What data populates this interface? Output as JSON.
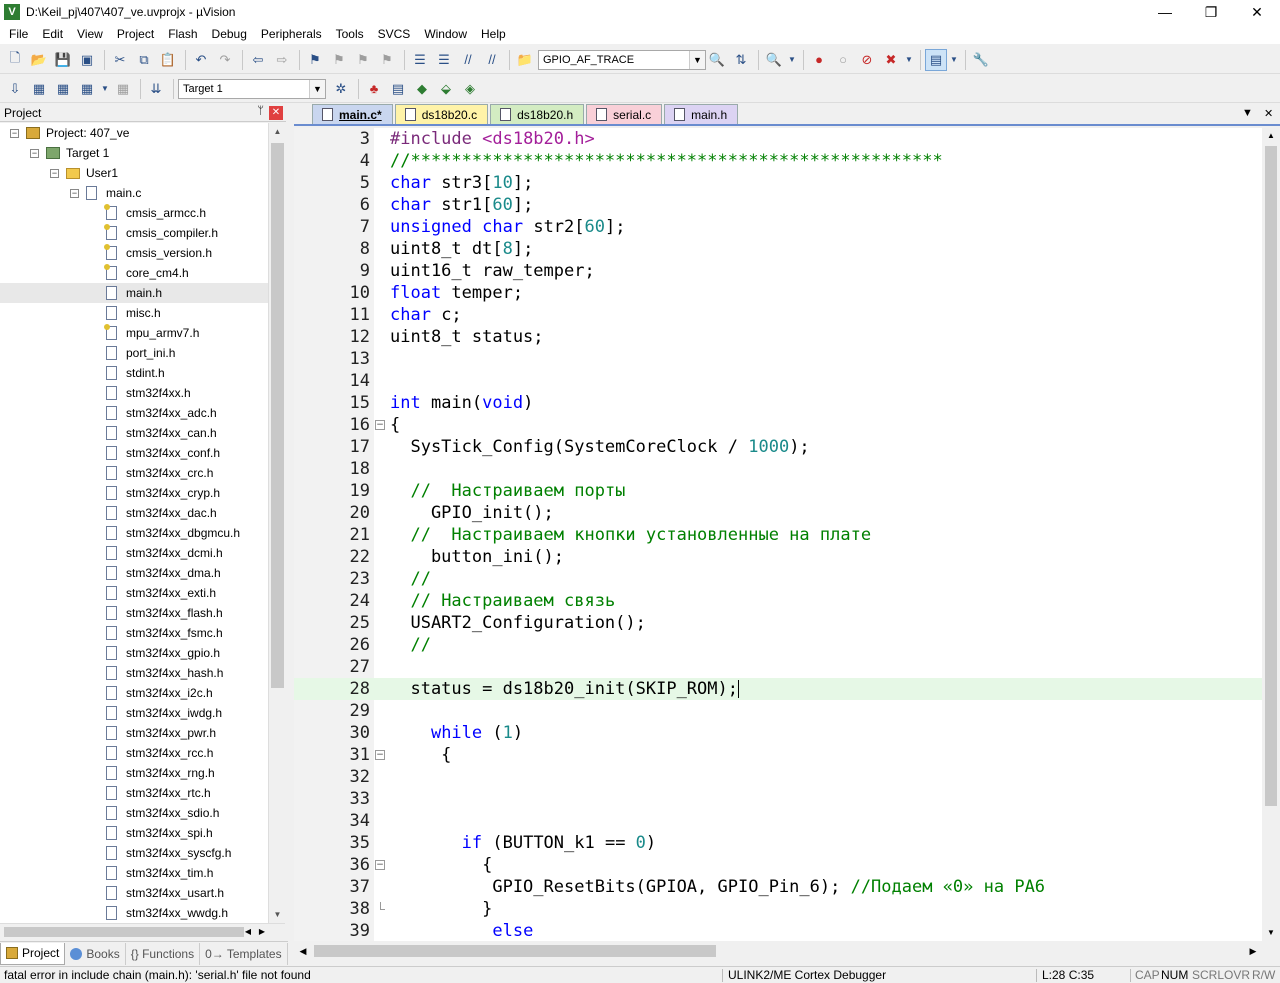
{
  "window": {
    "title": "D:\\Keil_pj\\407\\407_ve.uvprojx - µVision",
    "minimize": "—",
    "maximize": "❐",
    "close": "✕"
  },
  "menu": [
    "File",
    "Edit",
    "View",
    "Project",
    "Flash",
    "Debug",
    "Peripherals",
    "Tools",
    "SVCS",
    "Window",
    "Help"
  ],
  "toolbar1": {
    "find_combo": "GPIO_AF_TRACE"
  },
  "toolbar2": {
    "target_combo": "Target 1"
  },
  "project_pane": {
    "title": "Project",
    "pin": "ᛘ",
    "close": "✕",
    "tree": [
      {
        "label": "Project: 407_ve",
        "level": 0,
        "type": "proj",
        "expand": "−"
      },
      {
        "label": "Target 1",
        "level": 1,
        "type": "target",
        "expand": "−"
      },
      {
        "label": "User1",
        "level": 2,
        "type": "folder",
        "expand": "−"
      },
      {
        "label": "main.c",
        "level": 3,
        "type": "cfile",
        "expand": "−"
      },
      {
        "label": "cmsis_armcc.h",
        "level": 4,
        "type": "key"
      },
      {
        "label": "cmsis_compiler.h",
        "level": 4,
        "type": "key"
      },
      {
        "label": "cmsis_version.h",
        "level": 4,
        "type": "key"
      },
      {
        "label": "core_cm4.h",
        "level": 4,
        "type": "key"
      },
      {
        "label": "main.h",
        "level": 4,
        "type": "file",
        "selected": true
      },
      {
        "label": "misc.h",
        "level": 4,
        "type": "file"
      },
      {
        "label": "mpu_armv7.h",
        "level": 4,
        "type": "key"
      },
      {
        "label": "port_ini.h",
        "level": 4,
        "type": "file"
      },
      {
        "label": "stdint.h",
        "level": 4,
        "type": "file"
      },
      {
        "label": "stm32f4xx.h",
        "level": 4,
        "type": "file"
      },
      {
        "label": "stm32f4xx_adc.h",
        "level": 4,
        "type": "file"
      },
      {
        "label": "stm32f4xx_can.h",
        "level": 4,
        "type": "file"
      },
      {
        "label": "stm32f4xx_conf.h",
        "level": 4,
        "type": "file"
      },
      {
        "label": "stm32f4xx_crc.h",
        "level": 4,
        "type": "file"
      },
      {
        "label": "stm32f4xx_cryp.h",
        "level": 4,
        "type": "file"
      },
      {
        "label": "stm32f4xx_dac.h",
        "level": 4,
        "type": "file"
      },
      {
        "label": "stm32f4xx_dbgmcu.h",
        "level": 4,
        "type": "file"
      },
      {
        "label": "stm32f4xx_dcmi.h",
        "level": 4,
        "type": "file"
      },
      {
        "label": "stm32f4xx_dma.h",
        "level": 4,
        "type": "file"
      },
      {
        "label": "stm32f4xx_exti.h",
        "level": 4,
        "type": "file"
      },
      {
        "label": "stm32f4xx_flash.h",
        "level": 4,
        "type": "file"
      },
      {
        "label": "stm32f4xx_fsmc.h",
        "level": 4,
        "type": "file"
      },
      {
        "label": "stm32f4xx_gpio.h",
        "level": 4,
        "type": "file"
      },
      {
        "label": "stm32f4xx_hash.h",
        "level": 4,
        "type": "file"
      },
      {
        "label": "stm32f4xx_i2c.h",
        "level": 4,
        "type": "file"
      },
      {
        "label": "stm32f4xx_iwdg.h",
        "level": 4,
        "type": "file"
      },
      {
        "label": "stm32f4xx_pwr.h",
        "level": 4,
        "type": "file"
      },
      {
        "label": "stm32f4xx_rcc.h",
        "level": 4,
        "type": "file"
      },
      {
        "label": "stm32f4xx_rng.h",
        "level": 4,
        "type": "file"
      },
      {
        "label": "stm32f4xx_rtc.h",
        "level": 4,
        "type": "file"
      },
      {
        "label": "stm32f4xx_sdio.h",
        "level": 4,
        "type": "file"
      },
      {
        "label": "stm32f4xx_spi.h",
        "level": 4,
        "type": "file"
      },
      {
        "label": "stm32f4xx_syscfg.h",
        "level": 4,
        "type": "file"
      },
      {
        "label": "stm32f4xx_tim.h",
        "level": 4,
        "type": "file"
      },
      {
        "label": "stm32f4xx_usart.h",
        "level": 4,
        "type": "file"
      },
      {
        "label": "stm32f4xx_wwdg.h",
        "level": 4,
        "type": "file"
      }
    ],
    "bottom_tabs": [
      "Project",
      "Books",
      "{} Functions",
      "0→ Templates"
    ]
  },
  "editor_tabs": [
    "main.c*",
    "ds18b20.c",
    "ds18b20.h",
    "serial.c",
    "main.h"
  ],
  "code": [
    {
      "n": "3",
      "segs": [
        [
          "pp",
          "#include "
        ],
        [
          "inc",
          "<ds18b20.h>"
        ]
      ]
    },
    {
      "n": "4",
      "segs": [
        [
          "cm",
          "//****************************************************"
        ]
      ]
    },
    {
      "n": "5",
      "segs": [
        [
          "kw",
          "char"
        ],
        [
          "",
          " str3["
        ],
        [
          "num",
          "10"
        ],
        [
          "",
          "];"
        ]
      ]
    },
    {
      "n": "6",
      "segs": [
        [
          "kw",
          "char"
        ],
        [
          "",
          " str1["
        ],
        [
          "num",
          "60"
        ],
        [
          "",
          "];"
        ]
      ]
    },
    {
      "n": "7",
      "segs": [
        [
          "kw",
          "unsigned"
        ],
        [
          "",
          " "
        ],
        [
          "kw",
          "char"
        ],
        [
          "",
          " str2["
        ],
        [
          "num",
          "60"
        ],
        [
          "",
          "];"
        ]
      ]
    },
    {
      "n": "8",
      "segs": [
        [
          "",
          "uint8_t dt["
        ],
        [
          "num",
          "8"
        ],
        [
          "",
          "];"
        ]
      ]
    },
    {
      "n": "9",
      "segs": [
        [
          "",
          "uint16_t raw_temper;"
        ]
      ]
    },
    {
      "n": "10",
      "segs": [
        [
          "kw",
          "float"
        ],
        [
          "",
          " temper;"
        ]
      ]
    },
    {
      "n": "11",
      "segs": [
        [
          "kw",
          "char"
        ],
        [
          "",
          " c;"
        ]
      ]
    },
    {
      "n": "12",
      "segs": [
        [
          "",
          "uint8_t status;"
        ]
      ]
    },
    {
      "n": "13",
      "segs": []
    },
    {
      "n": "14",
      "segs": []
    },
    {
      "n": "15",
      "segs": [
        [
          "kw",
          "int"
        ],
        [
          "",
          " main("
        ],
        [
          "kw",
          "void"
        ],
        [
          "",
          ")"
        ]
      ]
    },
    {
      "n": "16",
      "fold": "open",
      "segs": [
        [
          "",
          "{"
        ]
      ]
    },
    {
      "n": "17",
      "segs": [
        [
          "",
          "  SysTick_Config(SystemCoreClock / "
        ],
        [
          "num",
          "1000"
        ],
        [
          "",
          ");"
        ]
      ]
    },
    {
      "n": "18",
      "segs": []
    },
    {
      "n": "19",
      "segs": [
        [
          "",
          "  "
        ],
        [
          "cm",
          "//  Настраиваем порты"
        ]
      ]
    },
    {
      "n": "20",
      "segs": [
        [
          "",
          "    GPIO_init();"
        ]
      ]
    },
    {
      "n": "21",
      "segs": [
        [
          "",
          "  "
        ],
        [
          "cm",
          "//  Настраиваем кнопки установленные на плате"
        ]
      ]
    },
    {
      "n": "22",
      "segs": [
        [
          "",
          "    button_ini();"
        ]
      ]
    },
    {
      "n": "23",
      "segs": [
        [
          "",
          "  "
        ],
        [
          "cm",
          "//"
        ]
      ]
    },
    {
      "n": "24",
      "segs": [
        [
          "",
          "  "
        ],
        [
          "cm",
          "// Настраиваем связь"
        ]
      ]
    },
    {
      "n": "25",
      "segs": [
        [
          "",
          "  USART2_Configuration();"
        ]
      ]
    },
    {
      "n": "26",
      "segs": [
        [
          "",
          "  "
        ],
        [
          "cm",
          "//"
        ]
      ]
    },
    {
      "n": "27",
      "segs": []
    },
    {
      "n": "28",
      "current": true,
      "segs": [
        [
          "",
          "  status = ds18b20_init(SKIP_ROM);"
        ]
      ]
    },
    {
      "n": "29",
      "segs": []
    },
    {
      "n": "30",
      "segs": [
        [
          "",
          "    "
        ],
        [
          "kw",
          "while"
        ],
        [
          "",
          " ("
        ],
        [
          "num",
          "1"
        ],
        [
          "",
          ")"
        ]
      ]
    },
    {
      "n": "31",
      "fold": "open",
      "segs": [
        [
          "",
          "     {"
        ]
      ]
    },
    {
      "n": "32",
      "segs": []
    },
    {
      "n": "33",
      "segs": []
    },
    {
      "n": "34",
      "segs": []
    },
    {
      "n": "35",
      "segs": [
        [
          "",
          "       "
        ],
        [
          "kw",
          "if"
        ],
        [
          "",
          " (BUTTON_k1 == "
        ],
        [
          "num",
          "0"
        ],
        [
          "",
          ")"
        ]
      ]
    },
    {
      "n": "36",
      "fold": "open",
      "segs": [
        [
          "",
          "         {"
        ]
      ]
    },
    {
      "n": "37",
      "segs": [
        [
          "",
          "          GPIO_ResetBits(GPIOA, GPIO_Pin_6); "
        ],
        [
          "cm",
          "//Подаем «0» на PA6"
        ]
      ]
    },
    {
      "n": "38",
      "fold": "end",
      "segs": [
        [
          "",
          "         }"
        ]
      ]
    },
    {
      "n": "39",
      "segs": [
        [
          "",
          "          "
        ],
        [
          "kw",
          "else"
        ]
      ]
    }
  ],
  "status": {
    "message": "fatal error in include chain (main.h): 'serial.h' file not found",
    "debugger": "ULINK2/ME Cortex Debugger",
    "position": "L:28 C:35",
    "cap": "CAP",
    "num": "NUM",
    "scrl": "SCRL",
    "ovr": "OVR",
    "rw": "R/W"
  }
}
